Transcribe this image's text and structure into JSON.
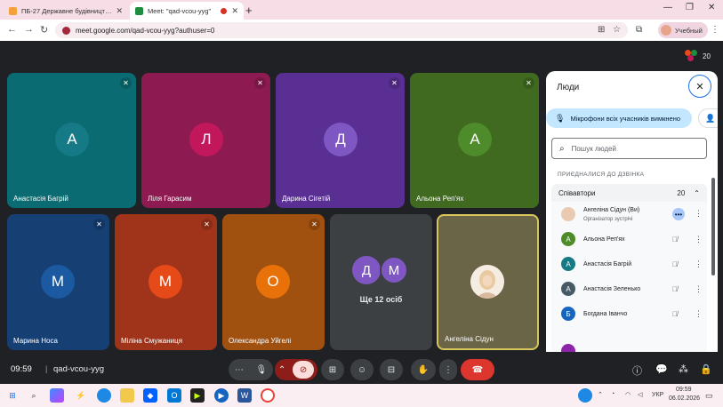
{
  "browser": {
    "tabs": [
      {
        "title": "ПБ-27 Державне будівництво",
        "favicon_color": "#f4a13c"
      },
      {
        "title": "Meet: \"qad-vcou-yyg\"",
        "favicon_color": "#1e8e3e"
      }
    ],
    "url": "meet.google.com/qad-vcou-yyg?authuser=0",
    "profile_label": "Учебный",
    "new_tab_glyph": "+",
    "window_controls": [
      "—",
      "❐",
      "✕"
    ]
  },
  "meet": {
    "participant_count": "20",
    "tiles": [
      {
        "name": "Анастасія Багрій",
        "initial": "А",
        "bg": "#0b6b72",
        "avatar": "#167a86",
        "muted": true
      },
      {
        "name": "Ліля Гарасим",
        "initial": "Л",
        "bg": "#8d1b52",
        "avatar": "#c2185b",
        "muted": true
      },
      {
        "name": "Дарина Сігетій",
        "initial": "Д",
        "bg": "#5a2f93",
        "avatar": "#7e57c2",
        "muted": true
      },
      {
        "name": "Альона Реп'ях",
        "initial": "А",
        "bg": "#3f6a1f",
        "avatar": "#4e8b2a",
        "muted": true
      },
      {
        "name": "Марина Носа",
        "initial": "М",
        "bg": "#163f73",
        "avatar": "#1b5aa0",
        "muted": true
      },
      {
        "name": "Міліна Смужаниця",
        "initial": "М",
        "bg": "#a0341a",
        "avatar": "#e64a19",
        "muted": true
      },
      {
        "name": "Олександра Уйгелі",
        "initial": "О",
        "bg": "#a0500f",
        "avatar": "#e8710a",
        "muted": true
      },
      {
        "name": "Ще 12 осіб",
        "initial": "",
        "bg": "#3c4043",
        "avatar": "#7e57c2",
        "muted": false
      },
      {
        "name": "Ангеліна Сідун",
        "initial": "",
        "bg": "#6b6548",
        "avatar": "#f0e2d4",
        "muted": false
      }
    ],
    "more_initials": [
      "Д",
      "М"
    ],
    "panel": {
      "title": "Люди",
      "mute_all_label": "Мікрофони всіх учасників вимкнено",
      "search_placeholder": "Пошук людей",
      "section_label": "ПРИЄДНАЛИСЯ ДО ДЗВІНКА",
      "group_label": "Співавтори",
      "group_count": "20",
      "people": [
        {
          "name": "Ангеліна Сідун (Ви)",
          "sub": "Організатор зустрічі",
          "initial": "",
          "color": "#e9c9b0"
        },
        {
          "name": "Альона Реп'ях",
          "sub": "",
          "initial": "А",
          "color": "#4e8b2a"
        },
        {
          "name": "Анастасія Багрій",
          "sub": "",
          "initial": "А",
          "color": "#167a86"
        },
        {
          "name": "Анастасія Зеленько",
          "sub": "",
          "initial": "А",
          "color": "#455a64"
        },
        {
          "name": "Богдана Іванчо",
          "sub": "",
          "initial": "Б",
          "color": "#1565c0"
        },
        {
          "name": "",
          "sub": "",
          "initial": "",
          "color": "#8e24aa"
        }
      ]
    },
    "bottom": {
      "time": "09:59",
      "code": "qad-vcou-yyg"
    }
  },
  "taskbar": {
    "lang": "УКР",
    "time": "09:59",
    "date": "06.02.2026"
  }
}
